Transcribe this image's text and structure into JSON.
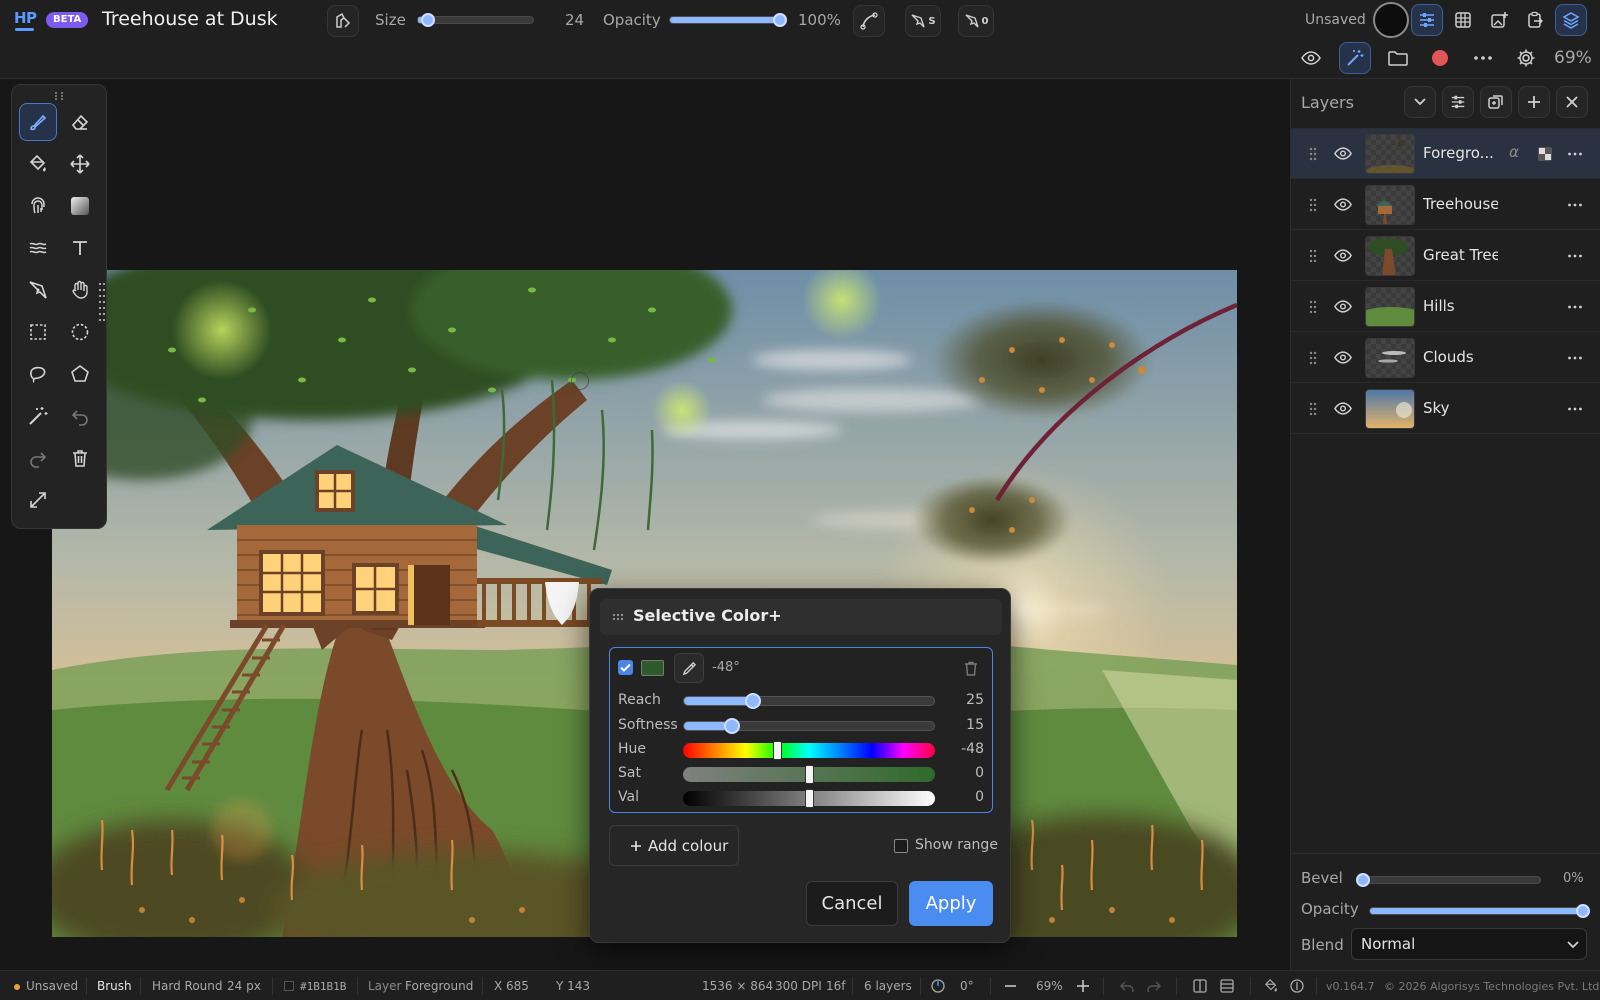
{
  "app": {
    "logo": "HP",
    "badge": "BETA",
    "document_title": "Treehouse at Dusk",
    "save_state": "Unsaved",
    "zoom": "69%"
  },
  "toolbar": {
    "size_label": "Size",
    "size_value": "24",
    "size_fraction": 0.03,
    "opacity_label": "Opacity",
    "opacity_value": "100%",
    "opacity_fraction": 1.0,
    "stabilizer_badge": "S",
    "pressure_badge": "0"
  },
  "layers": {
    "title": "Layers",
    "items": [
      {
        "name": "Foregro...",
        "selected": true
      },
      {
        "name": "Treehouse",
        "selected": false
      },
      {
        "name": "Great Tree",
        "selected": false
      },
      {
        "name": "Hills",
        "selected": false
      },
      {
        "name": "Clouds",
        "selected": false
      },
      {
        "name": "Sky",
        "selected": false
      }
    ],
    "alpha_symbol": "α",
    "bevel_label": "Bevel",
    "bevel_value": "0%",
    "opacity_label": "Opacity",
    "blend_label": "Blend",
    "blend_value": "Normal"
  },
  "dialog": {
    "title": "Selective Color+",
    "swatch_color": "#2d5a2a",
    "hue_shift": "-48°",
    "sliders": [
      {
        "label": "Reach",
        "value": "25",
        "fraction": 0.26
      },
      {
        "label": "Softness",
        "value": "15",
        "fraction": 0.17
      },
      {
        "label": "Hue",
        "value": "-48",
        "fraction": 0.37
      },
      {
        "label": "Sat",
        "value": "0",
        "fraction": 0.5
      },
      {
        "label": "Val",
        "value": "0",
        "fraction": 0.5
      }
    ],
    "add_colour": "Add colour",
    "show_range": "Show range",
    "cancel": "Cancel",
    "apply": "Apply"
  },
  "status": {
    "save_state": "Unsaved",
    "tool": "Brush",
    "brush": "Hard Round",
    "brush_size": "24 px",
    "color": "#1B1B1B",
    "layer_label": "Layer",
    "layer_name": "Foreground",
    "x": "X 685",
    "y": "Y 143",
    "dimensions": "1536 × 864",
    "dpi": "300 DPI",
    "depth": "16f",
    "layer_count": "6 layers",
    "rotation": "0°",
    "zoom": "69%",
    "version": "v0.164.7",
    "copyright": "© 2026 Algorisys Technologies Pvt. Ltd."
  },
  "colors": {
    "accent": "#4a86e8",
    "apply_button": "#4a8cf0",
    "record": "#e05555"
  }
}
